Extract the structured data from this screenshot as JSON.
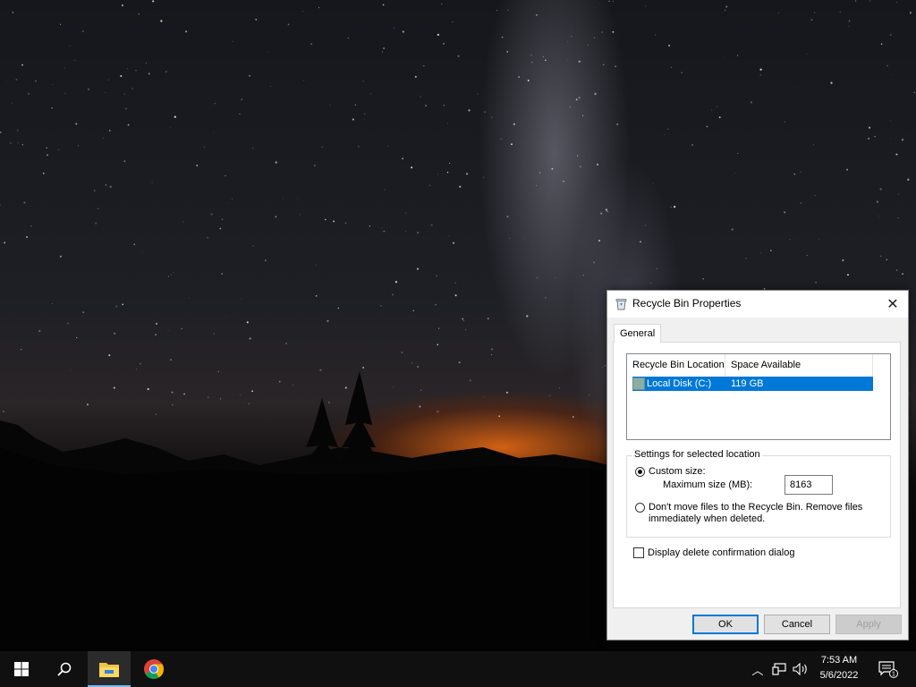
{
  "dialog": {
    "title": "Recycle Bin Properties",
    "close_label": "✕",
    "tab_general": "General",
    "list": {
      "columns": [
        "Recycle Bin Location",
        "Space Available"
      ],
      "rows": [
        {
          "location": "Local Disk (C:)",
          "space": "119 GB"
        }
      ]
    },
    "settings": {
      "group_label": "Settings for selected location",
      "custom_size_label": "Custom size:",
      "max_size_label": "Maximum size (MB):",
      "max_size_value": "8163",
      "dont_move_label_line1": "Don't move files to the Recycle Bin. Remove files",
      "dont_move_label_line2": "immediately when deleted."
    },
    "confirm_label": "Display delete confirmation dialog",
    "buttons": {
      "ok": "OK",
      "cancel": "Cancel",
      "apply": "Apply"
    }
  },
  "taskbar": {
    "apps": [
      "start-icon",
      "search-icon",
      "file-explorer-icon",
      "chrome-icon"
    ],
    "clock_time": "7:53 AM",
    "clock_date": "5/6/2022",
    "notification_count": "1"
  },
  "colors": {
    "selection": "#0078d7",
    "taskbar": "#101010",
    "accent": "#0078d7"
  }
}
